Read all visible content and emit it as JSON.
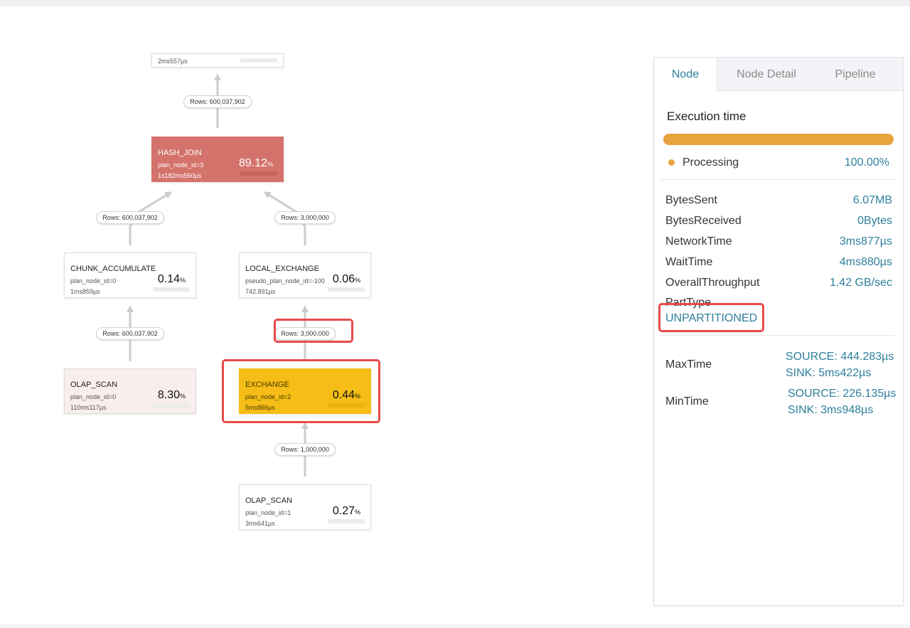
{
  "graph": {
    "nodes": [
      {
        "id": "top",
        "name": "",
        "line1": "",
        "line2": "2ms557µs",
        "pct": ""
      },
      {
        "id": "hash_join",
        "name": "HASH_JOIN",
        "line1": "plan_node_id=3",
        "line2": "1s182ms560µs",
        "pct": "89.12"
      },
      {
        "id": "chunk_acc",
        "name": "CHUNK_ACCUMULATE",
        "line1": "plan_node_id=0",
        "line2": "1ms859µs",
        "pct": "0.14"
      },
      {
        "id": "local_ex",
        "name": "LOCAL_EXCHANGE",
        "line1": "pseudo_plan_node_id=-100",
        "line2": "742.891µs",
        "pct": "0.06"
      },
      {
        "id": "olap0",
        "name": "OLAP_SCAN",
        "line1": "plan_node_id=0",
        "line2": "110ms117µs",
        "pct": "8.30"
      },
      {
        "id": "exchange",
        "name": "EXCHANGE",
        "line1": "plan_node_id=2",
        "line2": "5ms866µs",
        "pct": "0.44"
      },
      {
        "id": "olap1",
        "name": "OLAP_SCAN",
        "line1": "plan_node_id=1",
        "line2": "3ms641µs",
        "pct": "0.27"
      }
    ],
    "pct_unit": "%",
    "edges": [
      {
        "label": "Rows: 600,037,902"
      },
      {
        "label": "Rows: 600,037,902"
      },
      {
        "label": "Rows: 3,000,000"
      },
      {
        "label": "Rows: 600,037,902"
      },
      {
        "label": "Rows: 3,000,000"
      },
      {
        "label": "Rows: 1,000,000"
      }
    ]
  },
  "panel": {
    "tabs": [
      {
        "label": "Node",
        "active": true
      },
      {
        "label": "Node Detail",
        "active": false
      },
      {
        "label": "Pipeline",
        "active": false
      }
    ],
    "execution": {
      "title": "Execution time",
      "legend_label": "Processing",
      "legend_value": "100.00%",
      "processing_fraction": 1.0,
      "bar_color": "#e8a33e"
    },
    "metrics": [
      {
        "key": "BytesSent",
        "value": "6.07MB"
      },
      {
        "key": "BytesReceived",
        "value": "0Bytes"
      },
      {
        "key": "NetworkTime",
        "value": "3ms877µs"
      },
      {
        "key": "WaitTime",
        "value": "4ms880µs"
      },
      {
        "key": "OverallThroughput",
        "value": "1.42 GB/sec"
      },
      {
        "key": "PartType",
        "value": "UNPARTITIONED"
      }
    ],
    "ranges": [
      {
        "key": "MaxTime",
        "lines": [
          "SOURCE: 444.283µs",
          "SINK: 5ms422µs"
        ]
      },
      {
        "key": "MinTime",
        "lines": [
          "SOURCE: 226.135µs",
          "SINK: 3ms948µs"
        ]
      }
    ]
  },
  "colors": {
    "accent": "#2e7f9c",
    "hot_node": "#d4736b",
    "selected_node": "#f5bd16",
    "highlight": "#e84a4a"
  }
}
